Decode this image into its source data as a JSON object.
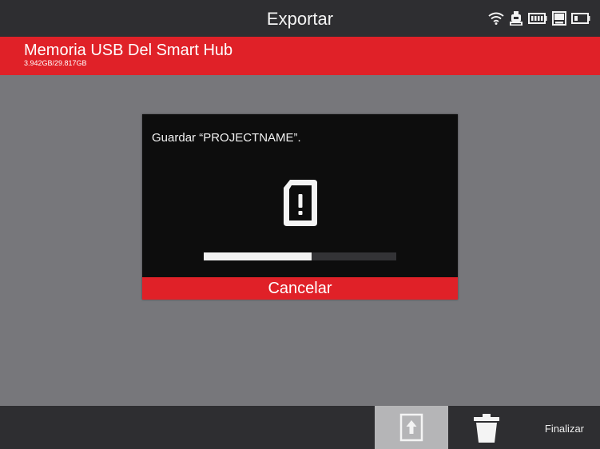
{
  "header": {
    "title": "Exportar",
    "status_icons": [
      "wifi-icon",
      "printer-icon",
      "battery-icon",
      "usb-storage-icon",
      "battery-level-icon"
    ]
  },
  "storage": {
    "name": "Memoria USB Del Smart Hub",
    "size": "3.942GB/29.817GB"
  },
  "dialog": {
    "message": "Guardar “PROJECTNAME”.",
    "icon": "file-warning-icon",
    "progress": 0.56,
    "cancel_label": "Cancelar"
  },
  "toolbar": {
    "export_icon": "export-upload-icon",
    "delete_icon": "trash-icon",
    "finish_label": "Finalizar"
  },
  "colors": {
    "accent": "#e02128",
    "bar": "#2e2e31",
    "background": "#77777b",
    "dialog": "#0d0d0d"
  }
}
